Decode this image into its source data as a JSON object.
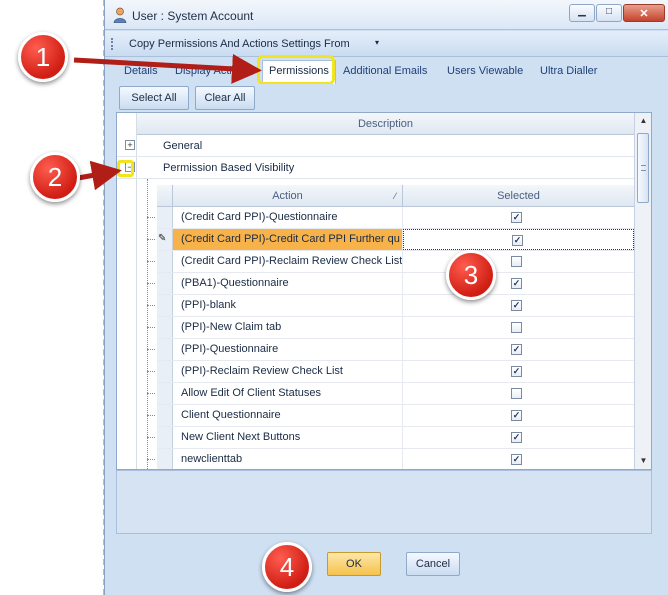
{
  "window": {
    "title": "User : System Account",
    "minimize_glyph": "▁",
    "maximize_glyph": "□",
    "close_glyph": "✕"
  },
  "menubar": {
    "item": "Copy Permissions And Actions Settings From",
    "caret": "▾"
  },
  "tabs": [
    {
      "label": "Details"
    },
    {
      "label": "Display Actions"
    },
    {
      "label": "Permissions",
      "active": true
    },
    {
      "label": "Additional Emails"
    },
    {
      "label": "Users Viewable"
    },
    {
      "label": "Ultra Dialler"
    }
  ],
  "toolbar": {
    "select_all": "Select All",
    "clear_all": "Clear All"
  },
  "grid": {
    "description_header": "Description",
    "groups": [
      {
        "label": "General",
        "expander": "+"
      },
      {
        "label": "Permission Based Visibility",
        "expander": "−"
      }
    ],
    "columns": {
      "action": "Action",
      "selected": "Selected",
      "sort_glyph": "⁄"
    },
    "rows": [
      {
        "action": "(Credit Card PPI)-Questionnaire",
        "selected": true
      },
      {
        "action": "(Credit Card PPI)-Credit Card PPI Further qu",
        "selected": true,
        "current": true
      },
      {
        "action": "(Credit Card PPI)-Reclaim Review Check List",
        "selected": false
      },
      {
        "action": "(PBA1)-Questionnaire",
        "selected": true
      },
      {
        "action": "(PPI)-blank",
        "selected": true
      },
      {
        "action": "(PPI)-New Claim tab",
        "selected": false
      },
      {
        "action": "(PPI)-Questionnaire",
        "selected": true
      },
      {
        "action": "(PPI)-Reclaim Review Check List",
        "selected": true
      },
      {
        "action": "Allow Edit Of Client Statuses",
        "selected": false
      },
      {
        "action": "Client Questionnaire",
        "selected": true
      },
      {
        "action": "New Client Next Buttons",
        "selected": true
      },
      {
        "action": "newclienttab",
        "selected": true
      }
    ],
    "check_glyph": "✓",
    "pencil_glyph": "✎",
    "scroll_up": "▲",
    "scroll_down": "▼"
  },
  "footer": {
    "ok": "OK",
    "cancel": "Cancel"
  },
  "callouts": [
    "1",
    "2",
    "3",
    "4"
  ],
  "colors": {
    "callout_red": "#d01e14",
    "highlight_yellow": "#f2e51f",
    "current_row_orange": "#f7b24a"
  }
}
